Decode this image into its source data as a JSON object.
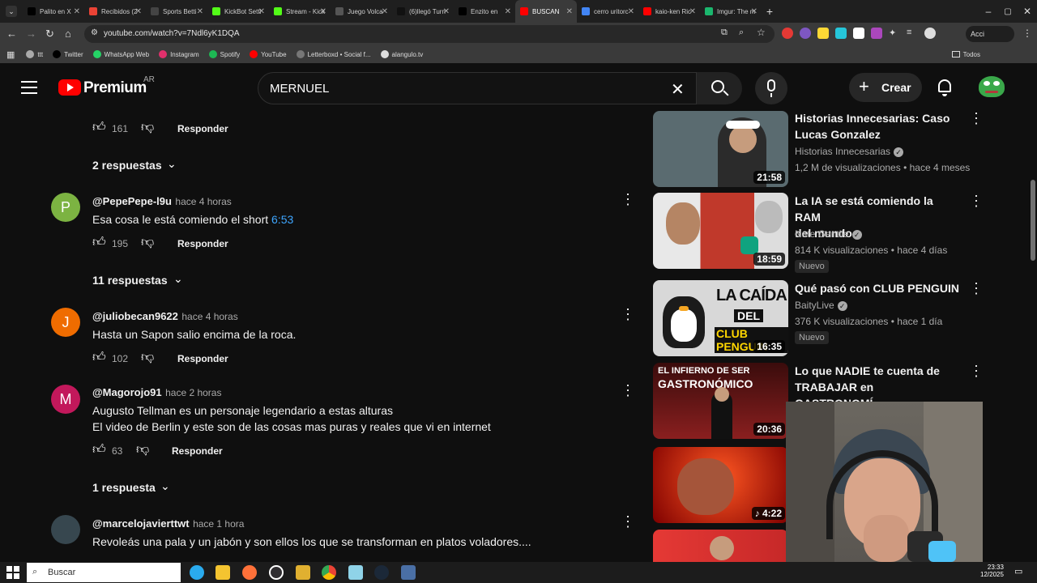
{
  "browser": {
    "tabs": [
      {
        "label": "Palito en X",
        "color": "#000000",
        "icon": "x-icon"
      },
      {
        "label": "Recibidos (2",
        "color": "#ea4335",
        "icon": "gmail-icon"
      },
      {
        "label": "Sports Betti",
        "color": "#444444",
        "icon": "globe-icon"
      },
      {
        "label": "KickBot Setti",
        "color": "#53fc18",
        "icon": "kick-icon"
      },
      {
        "label": "Stream - Kick",
        "color": "#53fc18",
        "icon": "kick-icon"
      },
      {
        "label": "Juego Volca",
        "color": "#555555",
        "icon": "globe-icon"
      },
      {
        "label": "(6)llegó Turn",
        "color": "#111111",
        "icon": "tiktok-icon"
      },
      {
        "label": "Enzito en",
        "color": "#000000",
        "icon": "x-icon"
      },
      {
        "label": "BUSCAN",
        "color": "#ff0000",
        "icon": "youtube-icon"
      },
      {
        "label": "cerro uritorc",
        "color": "#4285f4",
        "icon": "google-icon"
      },
      {
        "label": "kaio-ken Ric",
        "color": "#ff0000",
        "icon": "youtube-icon"
      },
      {
        "label": "Imgur: The m",
        "color": "#1bb76e",
        "icon": "imgur-icon"
      }
    ],
    "url": "youtube.com/watch?v=7Ndl6yK1DQA",
    "bookmarks": [
      {
        "label": "ttt",
        "color": "#aaaaaa"
      },
      {
        "label": "Twitter",
        "color": "#000000"
      },
      {
        "label": "WhatsApp Web",
        "color": "#25d366"
      },
      {
        "label": "Instagram",
        "color": "#e1306c"
      },
      {
        "label": "Spotify",
        "color": "#1db954"
      },
      {
        "label": "YouTube",
        "color": "#ff0000"
      },
      {
        "label": "Letterboxd • Social f...",
        "color": "#777777"
      },
      {
        "label": "alangulo.tv",
        "color": "#dddddd"
      }
    ],
    "all_bookmarks_label": "Todos",
    "profile_button": "Acci"
  },
  "header": {
    "brand": "Premium",
    "region": "AR",
    "search_value": "MERNUEL",
    "create_label": "Crear"
  },
  "comments": [
    {
      "likes": "161",
      "reply_label": "Responder",
      "replies_label": "2 respuestas"
    },
    {
      "avatar_letter": "P",
      "avatar_color": "#7cb342",
      "author": "@PepePepe-l9u",
      "time": "hace 4 horas",
      "text": "Esa cosa le está comiendo el short ",
      "timestamp_link": "6:53",
      "likes": "195",
      "reply_label": "Responder",
      "replies_label": "11 respuestas"
    },
    {
      "avatar_letter": "J",
      "avatar_color": "#ef6c00",
      "author": "@juliobecan9622",
      "time": "hace 4 horas",
      "text": "Hasta un Sapon salio encima de la roca.",
      "likes": "102",
      "reply_label": "Responder"
    },
    {
      "avatar_letter": "M",
      "avatar_color": "#c2185b",
      "author": "@Magorojo91",
      "time": "hace 2 horas",
      "text_line1": "Augusto Tellman es un personaje legendario a estas alturas",
      "text_line2": "El video de Berlin y este son de las cosas mas puras y reales que vi en internet",
      "likes": "63",
      "reply_label": "Responder",
      "replies_label": "1 respuesta"
    },
    {
      "author": "@marcelojavierttwt",
      "time": "hace 1 hora",
      "text": "Revoleás una pala y un jabón y son ellos los que se transforman en platos voladores...."
    }
  ],
  "sidebar": [
    {
      "title_line1": "Historias Innecesarias: Caso",
      "title_line2": "Lucas Gonzalez",
      "channel": "Historias Innecesarias",
      "meta": "1,2 M de visualizaciones • hace 4 meses",
      "duration": "21:58",
      "thumb_color": "#5a6b70"
    },
    {
      "title_line1": "La IA se está comiendo la RAM",
      "title_line2": "del mundo",
      "channel": "Nate Gentile",
      "meta": "814 K visualizaciones • hace 4 días",
      "badge": "Nuevo",
      "duration": "18:59",
      "thumb_color": "#c0392b"
    },
    {
      "title_line1": "Qué pasó con CLUB PENGUIN",
      "channel": "BaityLive",
      "meta": "376 K visualizaciones • hace 1 día",
      "badge": "Nuevo",
      "duration": "16:35",
      "thumb_color": "#e8e8e8",
      "thumb_text1": "LA CAÍDA",
      "thumb_text2": "DEL",
      "thumb_text3": "CLUB PENGUIN"
    },
    {
      "title_line1": "Lo que NADIE te cuenta de",
      "title_line2": "TRABAJAR en GASTRONOMÍ...",
      "duration": "20:36",
      "thumb_color": "#7a1a1a",
      "thumb_text1": "EL INFIERNO DE SER",
      "thumb_text2": "GASTRONÓMICO"
    },
    {
      "duration": "4:22",
      "thumb_color": "#b71c1c"
    },
    {
      "thumb_color": "#c62828"
    }
  ],
  "taskbar": {
    "search_placeholder": "Buscar",
    "time": "23:33",
    "date": "12/2025"
  }
}
